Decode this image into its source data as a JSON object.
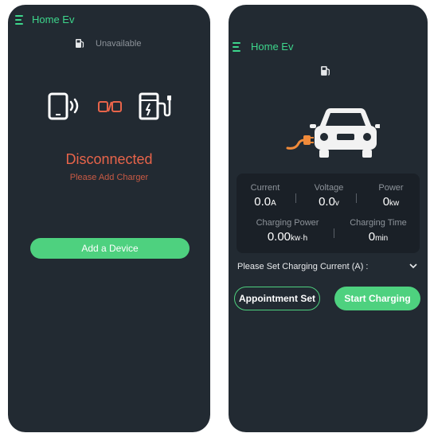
{
  "left_screen": {
    "app_title": "Home Ev",
    "status_text": "Unavailable",
    "connection_title": "Disconnected",
    "connection_subtitle": "Please Add Charger",
    "add_device_label": "Add a Device",
    "icons": [
      "menu-icon",
      "fuel-pump-icon",
      "phone-signal-icon",
      "broken-link-icon",
      "charging-station-icon"
    ]
  },
  "right_screen": {
    "app_title": "Home Ev",
    "stats": {
      "current": {
        "label": "Current",
        "value": "0.0",
        "unit": "A"
      },
      "voltage": {
        "label": "Voltage",
        "value": "0.0",
        "unit": "v"
      },
      "power": {
        "label": "Power",
        "value": "0",
        "unit": "kw"
      },
      "charging_power": {
        "label": "Charging Power",
        "value": "0.00",
        "unit": "kw·h"
      },
      "charging_time": {
        "label": "Charging Time",
        "value": "0",
        "unit": "min"
      }
    },
    "set_current_label": "Please Set Charging Current (A) :",
    "appointment_label": "Appointment Set",
    "start_label": "Start Charging",
    "icons": [
      "menu-icon",
      "fuel-pump-icon",
      "car-icon",
      "plug-icon",
      "chevron-down-icon"
    ]
  },
  "colors": {
    "background": "#222a32",
    "accent": "#4ed17f",
    "error": "#e8644a",
    "muted": "#8d939a"
  }
}
